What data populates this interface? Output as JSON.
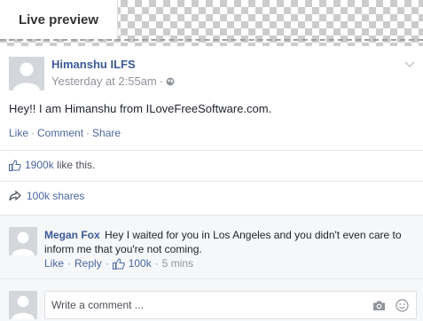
{
  "tab": {
    "label": "Live preview"
  },
  "post": {
    "author": "Himanshu ILFS",
    "timestamp": "Yesterday at 2:55am",
    "meta_separator": "·",
    "text": "Hey!! I am Himanshu from ILoveFreeSoftware.com.",
    "actions": {
      "like": "Like",
      "comment": "Comment",
      "share": "Share",
      "separator": "·"
    },
    "likes": {
      "count": "1900k",
      "suffix": "like this."
    },
    "shares": {
      "label": "100k shares"
    }
  },
  "comment": {
    "author": "Megan Fox",
    "text": "Hey I waited for you in Los Angeles and you didn't even care to inform me that you're not coming.",
    "actions": {
      "like": "Like",
      "reply": "Reply",
      "likes": "100k",
      "time": "5 mins",
      "separator": "·"
    }
  },
  "composer": {
    "placeholder": "Write a comment ..."
  },
  "colors": {
    "link": "#3b5998",
    "action": "#4b67a1",
    "muted": "#90949c",
    "avatar": "#d3d6db"
  }
}
